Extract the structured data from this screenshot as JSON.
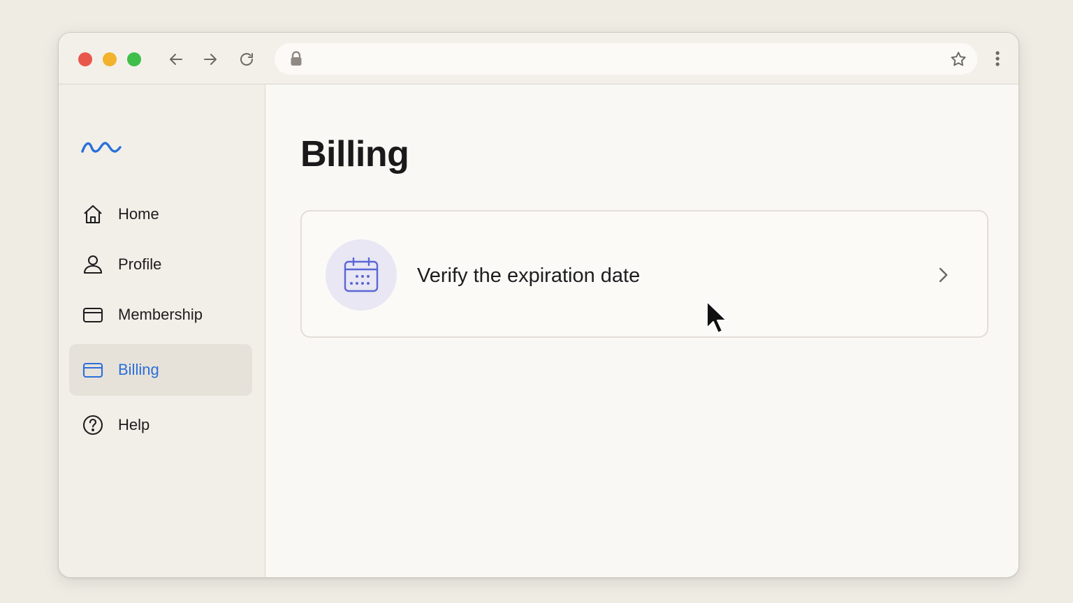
{
  "browser": {
    "address_url": "",
    "icons": [
      "back-arrow-icon",
      "forward-arrow-icon",
      "reload-icon",
      "lock-icon",
      "star-icon",
      "menu-dots-icon"
    ]
  },
  "sidebar": {
    "logo": "wave-logo-icon",
    "items": [
      {
        "label": "Home",
        "icon": "home-icon"
      },
      {
        "label": "Profile",
        "icon": "user-icon"
      },
      {
        "label": "Membership",
        "icon": "card-icon"
      },
      {
        "label": "Billing",
        "icon": "credit-card-icon",
        "active": true
      },
      {
        "label": "Help",
        "icon": "help-circle-icon"
      }
    ]
  },
  "main": {
    "title": "Billing",
    "card": {
      "label": "Verify the expiration date",
      "icon": "calendar-icon"
    }
  },
  "colors": {
    "accent": "#2a6fdb",
    "calendar_icon": "#5b66d6",
    "calendar_bg": "#e8e7f3",
    "light_red": "#e9574b",
    "light_yellow": "#f2b22c",
    "light_green": "#3fbf4a"
  }
}
